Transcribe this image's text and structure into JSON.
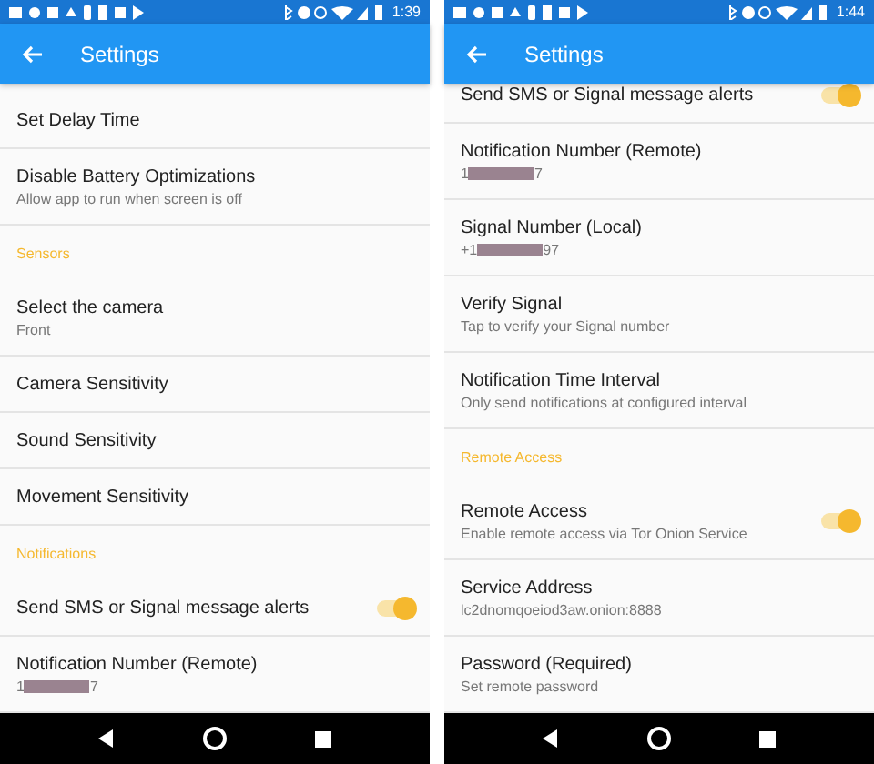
{
  "screens": [
    {
      "time": "1:39",
      "title": "Settings",
      "items": [
        {
          "kind": "item",
          "title": "Set Delay Time"
        },
        {
          "kind": "item",
          "title": "Disable Battery Optimizations",
          "subtitle": "Allow app to run when screen is off"
        },
        {
          "kind": "header",
          "title": "Sensors"
        },
        {
          "kind": "item",
          "title": "Select the camera",
          "subtitle": "Front"
        },
        {
          "kind": "item",
          "title": "Camera Sensitivity"
        },
        {
          "kind": "item",
          "title": "Sound Sensitivity"
        },
        {
          "kind": "item",
          "title": "Movement Sensitivity"
        },
        {
          "kind": "header",
          "title": "Notifications"
        },
        {
          "kind": "switch",
          "title": "Send SMS or Signal message alerts",
          "on": true
        },
        {
          "kind": "redacted",
          "title": "Notification Number (Remote)",
          "value_start": "1",
          "value_end": "7"
        }
      ]
    },
    {
      "time": "1:44",
      "title": "Settings",
      "items": [
        {
          "kind": "switch",
          "title": "Send SMS or Signal message alerts",
          "on": true
        },
        {
          "kind": "redacted",
          "title": "Notification Number (Remote)",
          "value_start": "1",
          "value_end": "7"
        },
        {
          "kind": "redacted",
          "title": "Signal Number (Local)",
          "value_start": "+1",
          "value_end": "97"
        },
        {
          "kind": "item",
          "title": "Verify Signal",
          "subtitle": "Tap to verify your Signal number"
        },
        {
          "kind": "item",
          "title": "Notification Time Interval",
          "subtitle": "Only send notifications at configured interval"
        },
        {
          "kind": "header",
          "title": "Remote Access"
        },
        {
          "kind": "switch",
          "title": "Remote Access",
          "subtitle": "Enable remote access via Tor Onion Service",
          "on": true
        },
        {
          "kind": "item",
          "title": "Service Address",
          "subtitle": "lc2dnomqoeiod3aw.onion:8888"
        },
        {
          "kind": "item",
          "title": "Password (Required)",
          "subtitle": "Set remote password"
        }
      ]
    }
  ]
}
